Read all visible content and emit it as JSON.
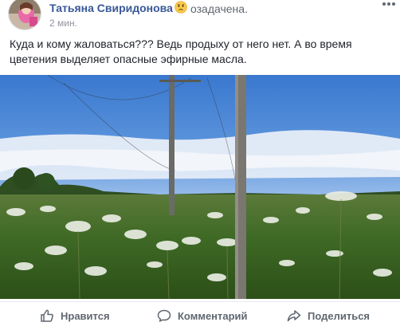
{
  "post": {
    "author": "Татьяна Свиридонова",
    "feeling_icon": "worried-face-emoji",
    "feeling": "озадачена.",
    "timestamp": "2 мин.",
    "text": "Куда и кому жаловаться??? Ведь продыху от него нет. А во время цветения выделяет опасные эфирные масла.",
    "photo_subject": "field-of-hogweed-with-utility-poles"
  },
  "actions": {
    "like_label": "Нравится",
    "comment_label": "Комментарий",
    "share_label": "Поделиться"
  },
  "colors": {
    "author_link": "#385898",
    "secondary_text": "#606770",
    "timestamp": "#90949c",
    "divider": "#e9ebee"
  }
}
